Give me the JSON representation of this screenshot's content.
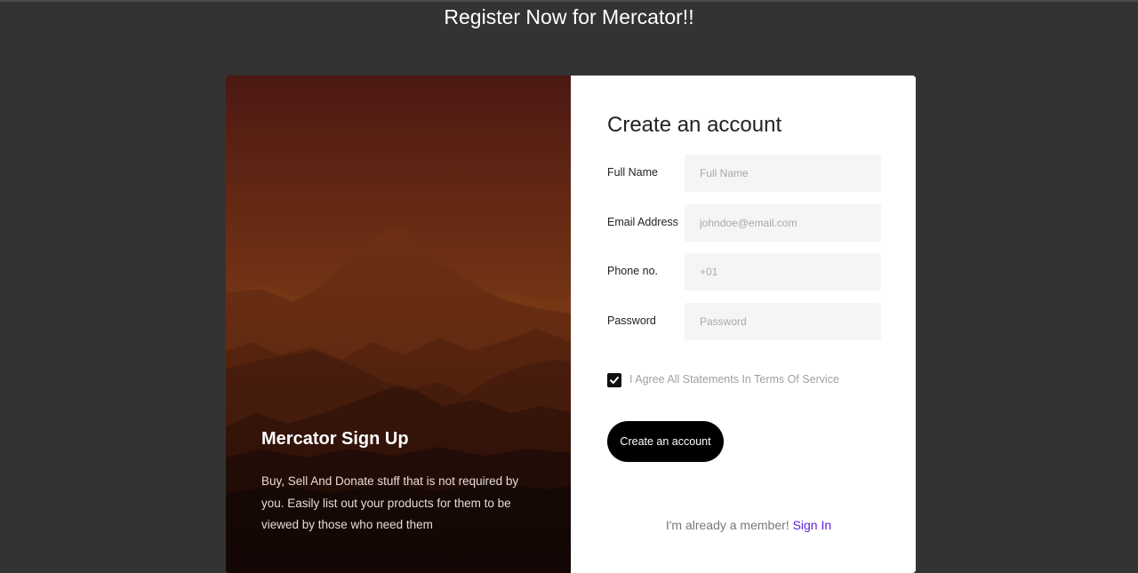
{
  "page": {
    "title": "Register Now for Mercator!!"
  },
  "hero": {
    "title": "Mercator Sign Up",
    "description": "Buy, Sell And Donate stuff that is not required by you. Easily list out your products for them to be viewed by those who need them",
    "image": "mountain-landscape"
  },
  "form": {
    "heading": "Create an account",
    "fields": [
      {
        "label": "Full Name",
        "placeholder": "Full Name",
        "value": ""
      },
      {
        "label": "Email Address",
        "placeholder": "johndoe@email.com",
        "value": ""
      },
      {
        "label": "Phone no.",
        "placeholder": "+01",
        "value": ""
      },
      {
        "label": "Password",
        "placeholder": "Password",
        "value": ""
      }
    ],
    "terms": {
      "label": "I Agree All Statements In Terms Of Service",
      "checked": true
    },
    "submit_label": "Create an account",
    "signin_prompt": "I'm already a member!",
    "signin_link": "Sign In"
  },
  "colors": {
    "background": "#333333",
    "link": "#5b21d6",
    "button": "#000000"
  }
}
